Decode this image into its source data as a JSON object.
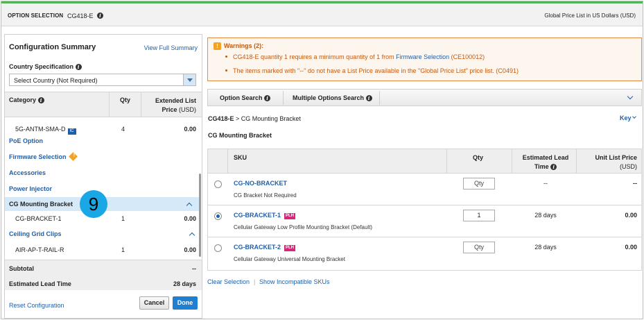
{
  "header": {
    "title": "OPTION SELECTION",
    "product_id": "CG418-E",
    "price_list": "Global Price List in US Dollars (USD)"
  },
  "summary": {
    "title": "Configuration Summary",
    "view_full": "View Full Summary",
    "country_label": "Country Specification",
    "country_value": "Select Country (Not Required)",
    "columns": {
      "category": "Category",
      "qty": "Qty",
      "price_line1": "Extended List",
      "price_line2": "Price",
      "price_unit": "(USD)"
    },
    "rows": [
      {
        "type": "item",
        "name": "5G-ANTM-SMA-D",
        "badge": "IC",
        "qty": "4",
        "price": "0.00"
      },
      {
        "type": "section",
        "name": "PoE Option"
      },
      {
        "type": "section",
        "name": "Firmware Selection",
        "warning": true
      },
      {
        "type": "section",
        "name": "Accessories"
      },
      {
        "type": "section",
        "name": "Power Injector"
      },
      {
        "type": "section",
        "name": "CG Mounting Bracket",
        "expanded": true,
        "highlighted": true
      },
      {
        "type": "item",
        "name": "CG-BRACKET-1",
        "qty": "1",
        "price": "0.00"
      },
      {
        "type": "section",
        "name": "Ceiling Grid Clips",
        "expanded": true
      },
      {
        "type": "item",
        "name": "AIR-AP-T-RAIL-R",
        "qty": "1",
        "price": "0.00"
      }
    ],
    "subtotal_label": "Subtotal",
    "subtotal_value": "--",
    "lead_time_label": "Estimated Lead Time",
    "lead_time_value": "28 days",
    "reset": "Reset Configuration",
    "cancel": "Cancel",
    "done": "Done",
    "callout_number": "9"
  },
  "warnings": {
    "title": "Warnings (2):",
    "w1_prefix": "CG418-E quantity 1 requires a minimum quantity of 1 from ",
    "w1_link": "Firmware Selection",
    "w1_suffix": " (CE100012)",
    "w2": "The items marked with \"--\" do not have a List Price available in the \"Global Price List\" price list. (C0491)"
  },
  "tabs": {
    "option_search": "Option Search",
    "multiple_search": "Multiple Options Search"
  },
  "breadcrumb": {
    "root": "CG418-E",
    "sep": " > ",
    "current": "CG Mounting Bracket"
  },
  "key_label": "Key",
  "section_title": "CG Mounting Bracket",
  "table": {
    "headers": {
      "sku": "SKU",
      "qty": "Qty",
      "lead_line1": "Estimated Lead",
      "lead_line2": "Time",
      "price_line1": "Unit List Price",
      "price_line2": "(USD)"
    },
    "rows": [
      {
        "sku": "CG-NO-BRACKET",
        "plh": "",
        "desc": "CG Bracket Not Required",
        "qty": "Qty",
        "lead": "--",
        "price": "--",
        "selected": false
      },
      {
        "sku": "CG-BRACKET-1",
        "plh": "PLH",
        "desc": "Cellular Gateway Low Profile Mounting Bracket (Default)",
        "qty": "1",
        "lead": "28 days",
        "price": "0.00",
        "selected": true
      },
      {
        "sku": "CG-BRACKET-2",
        "plh": "PLH",
        "desc": "Cellular Gateway Universal Mounting Bracket",
        "qty": "Qty",
        "lead": "28 days",
        "price": "0.00",
        "selected": false
      }
    ]
  },
  "footer_links": {
    "clear": "Clear Selection",
    "show": "Show Incompatible SKUs",
    "sep": "|"
  }
}
